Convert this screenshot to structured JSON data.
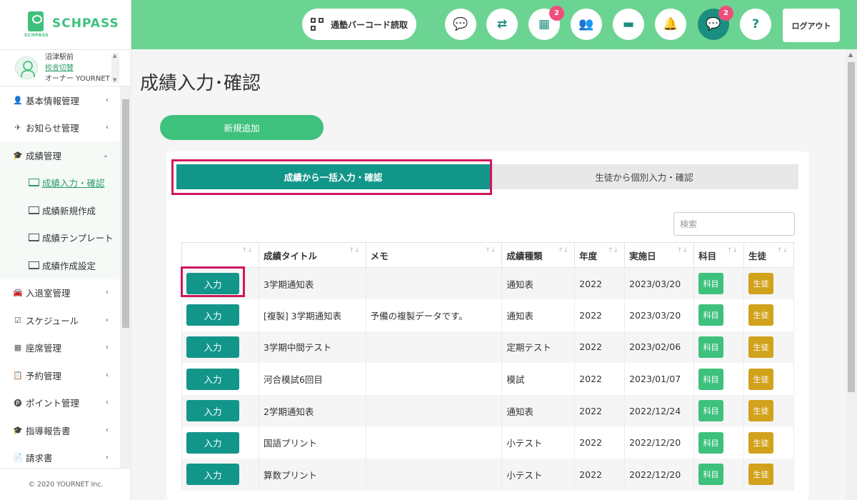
{
  "brand": {
    "name": "SCHPASS",
    "sub": "SCHPASS"
  },
  "user": {
    "school": "沼津駅前",
    "switch_link": "校舎切替",
    "role": "オーナー YOURNET"
  },
  "sidebar": {
    "items": [
      {
        "icon": "👤",
        "label": "基本情報管理"
      },
      {
        "icon": "✈",
        "label": "お知らせ管理"
      },
      {
        "icon": "🎓",
        "label": "成績管理"
      },
      {
        "icon": "🚘",
        "label": "入退室管理"
      },
      {
        "icon": "☑",
        "label": "スケジュール"
      },
      {
        "icon": "▦",
        "label": "座席管理"
      },
      {
        "icon": "📋",
        "label": "予約管理"
      },
      {
        "icon": "🅟",
        "label": "ポイント管理"
      },
      {
        "icon": "🎓",
        "label": "指導報告書"
      },
      {
        "icon": "📄",
        "label": "請求書"
      }
    ],
    "subitems": [
      "成績入力・確認",
      "成績新規作成",
      "成績テンプレート",
      "成績作成設定"
    ],
    "footer": "© 2020 YOURNET Inc."
  },
  "header": {
    "barcode_label": "通塾バーコード読取",
    "badge_calendar": "2",
    "badge_chat": "2",
    "help": "?",
    "logout_label": "ログアウト"
  },
  "page": {
    "title": "成績入力･確認",
    "new_button": "新規追加",
    "tab_bulk": "成績から一括入力・確認",
    "tab_individual": "生徒から個別入力・確認",
    "search_placeholder": "検索"
  },
  "table": {
    "headers": [
      "",
      "成績タイトル",
      "メモ",
      "成績種類",
      "年度",
      "実施日",
      "科目",
      "生徒"
    ],
    "action_label": "入力",
    "subject_tag": "科目",
    "student_tag": "生徒",
    "rows": [
      {
        "title": "3学期通知表",
        "memo": "",
        "type": "通知表",
        "year": "2022",
        "date": "2023/03/20"
      },
      {
        "title": "[複製] 3学期通知表",
        "memo": "予備の複製データです。",
        "type": "通知表",
        "year": "2022",
        "date": "2023/03/20"
      },
      {
        "title": "3学期中間テスト",
        "memo": "",
        "type": "定期テスト",
        "year": "2022",
        "date": "2023/02/06"
      },
      {
        "title": "河合模試6回目",
        "memo": "",
        "type": "模試",
        "year": "2022",
        "date": "2023/01/07"
      },
      {
        "title": "2学期通知表",
        "memo": "",
        "type": "通知表",
        "year": "2022",
        "date": "2022/12/24"
      },
      {
        "title": "国語プリント",
        "memo": "",
        "type": "小テスト",
        "year": "2022",
        "date": "2022/12/20"
      },
      {
        "title": "算数プリント",
        "memo": "",
        "type": "小テスト",
        "year": "2022",
        "date": "2022/12/20"
      }
    ]
  }
}
